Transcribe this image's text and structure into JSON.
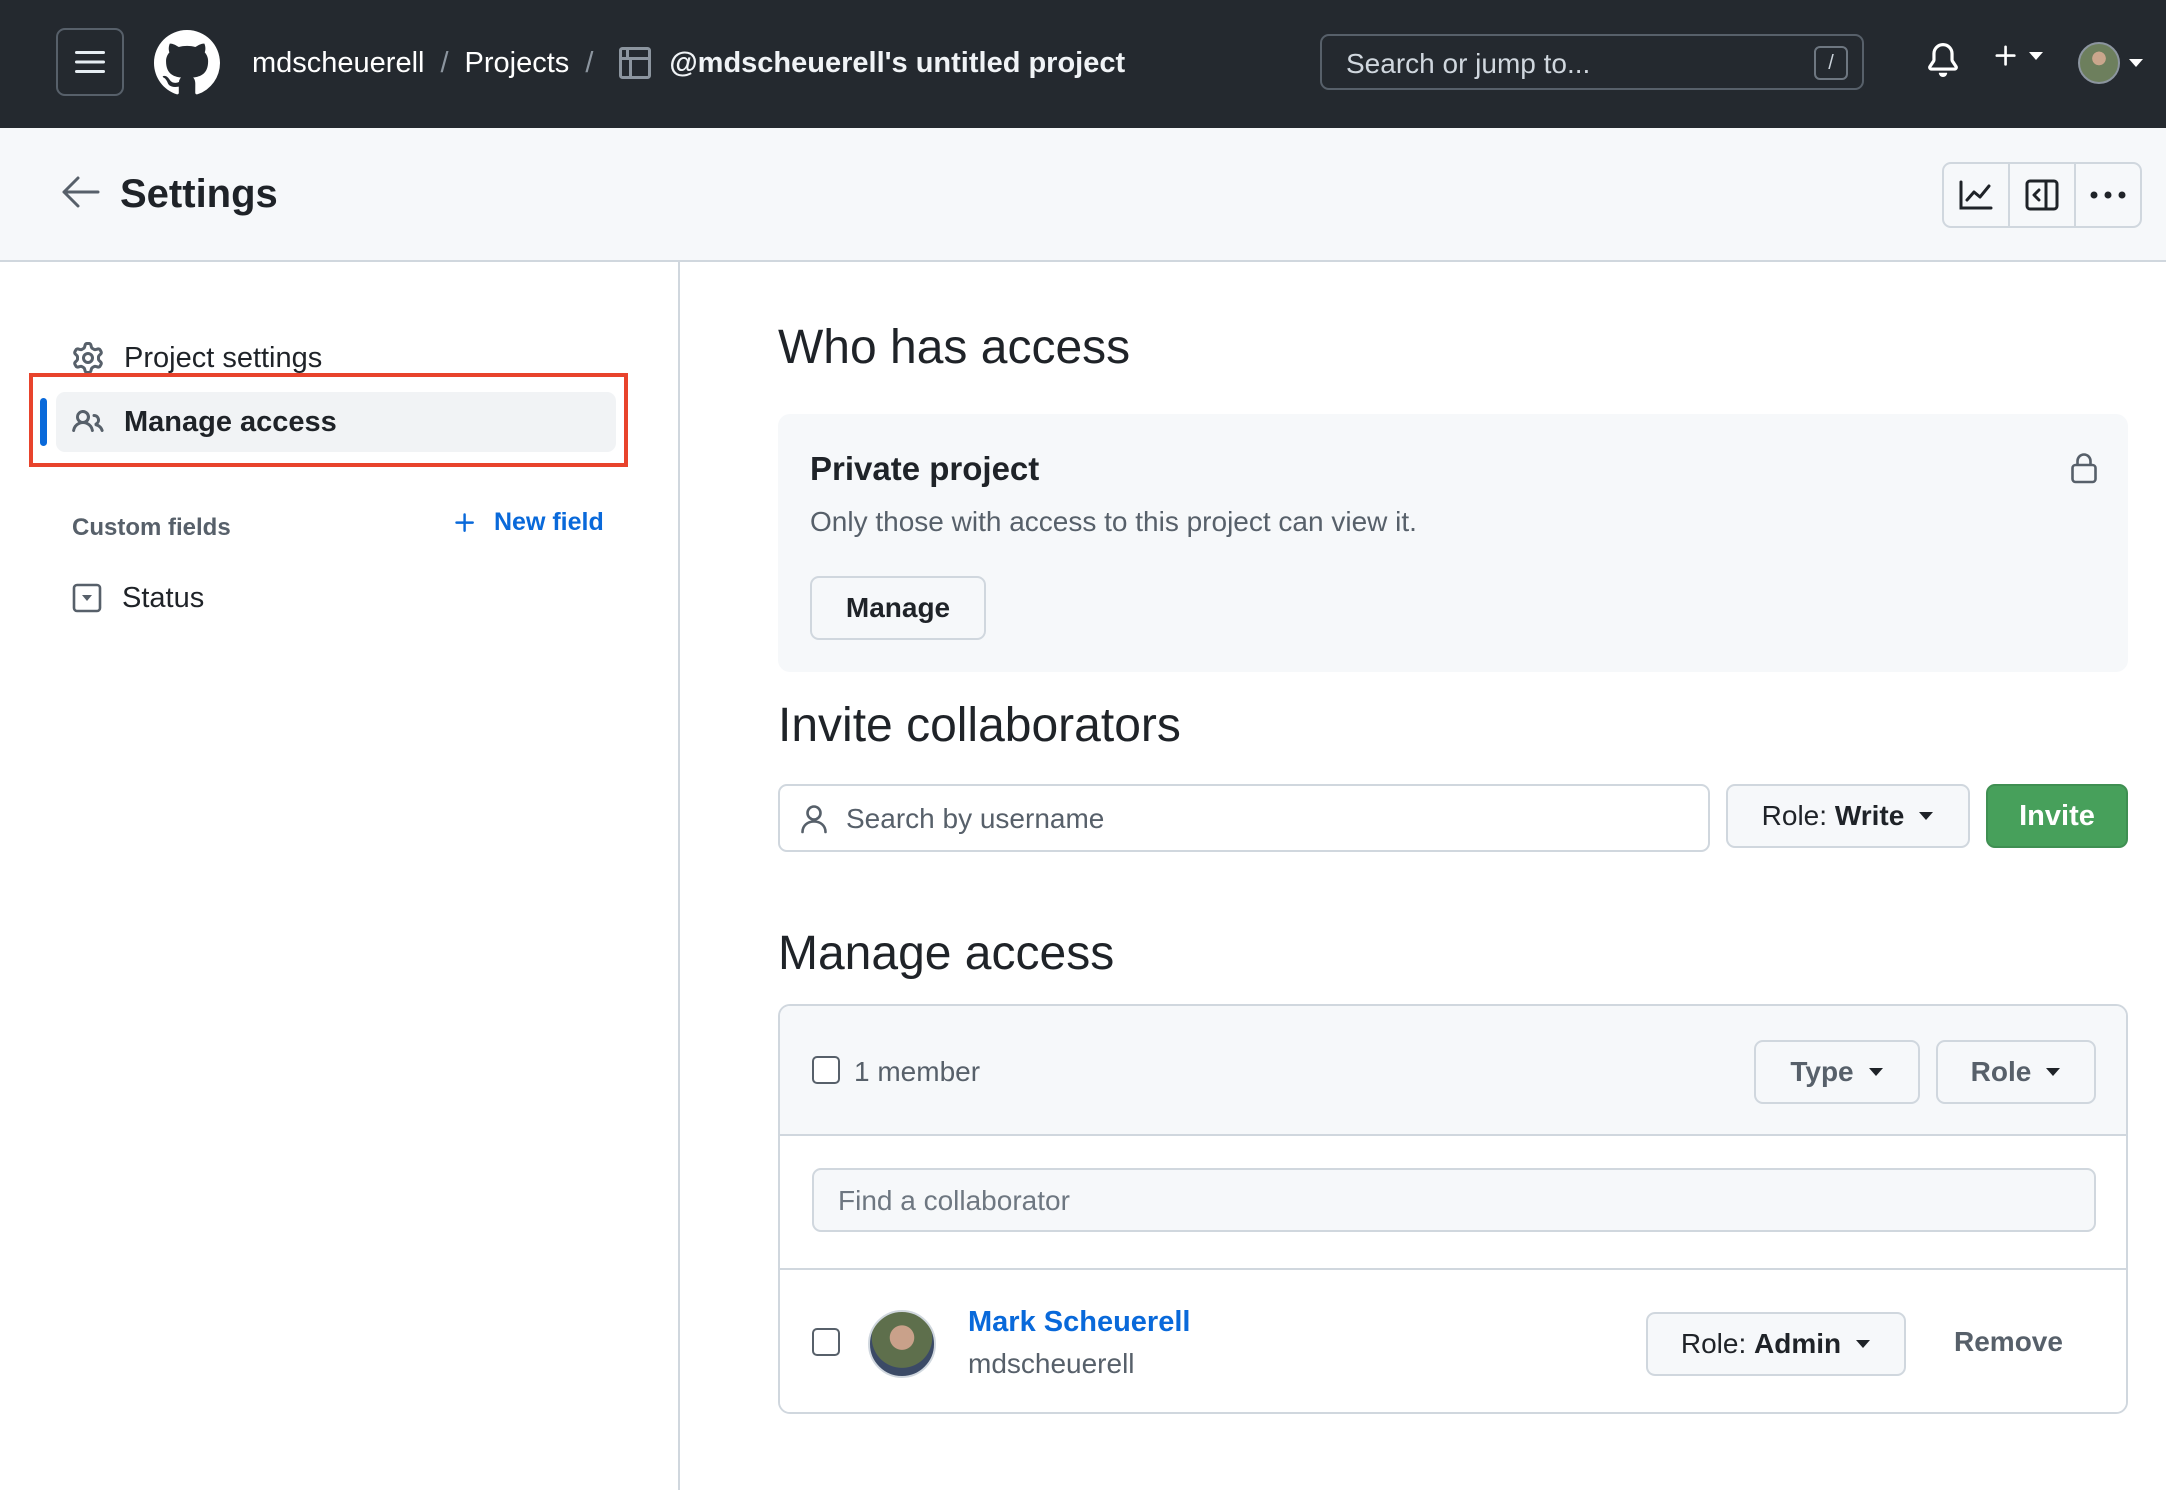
{
  "header": {
    "owner": "mdscheuerell",
    "projects_link": "Projects",
    "project_title": "@mdscheuerell's untitled project",
    "search_placeholder": "Search or jump to...",
    "search_shortcut": "/"
  },
  "subheader": {
    "title": "Settings"
  },
  "sidebar": {
    "items": [
      {
        "label": "Project settings",
        "icon": "gear-icon"
      },
      {
        "label": "Manage access",
        "icon": "people-icon",
        "active": true
      }
    ],
    "custom_fields_label": "Custom fields",
    "new_field_label": "New field",
    "fields": [
      {
        "label": "Status",
        "icon": "single-select-icon"
      }
    ]
  },
  "who_has_access": {
    "heading": "Who has access",
    "visibility_title": "Private project",
    "visibility_desc": "Only those with access to this project can view it.",
    "manage_label": "Manage"
  },
  "invite": {
    "heading": "Invite collaborators",
    "search_placeholder": "Search by username",
    "role_prefix": "Role:",
    "role_value": "Write",
    "invite_label": "Invite"
  },
  "manage_access": {
    "heading": "Manage access",
    "member_count": "1 member",
    "type_filter": "Type",
    "role_filter": "Role",
    "find_placeholder": "Find a collaborator",
    "members": [
      {
        "name": "Mark Scheuerell",
        "login": "mdscheuerell",
        "role_prefix": "Role:",
        "role": "Admin",
        "remove_label": "Remove"
      }
    ]
  },
  "colors": {
    "header_bg": "#24292f",
    "accent": "#0969da",
    "invite_green": "#47a05b",
    "highlight": "#e8432c"
  }
}
